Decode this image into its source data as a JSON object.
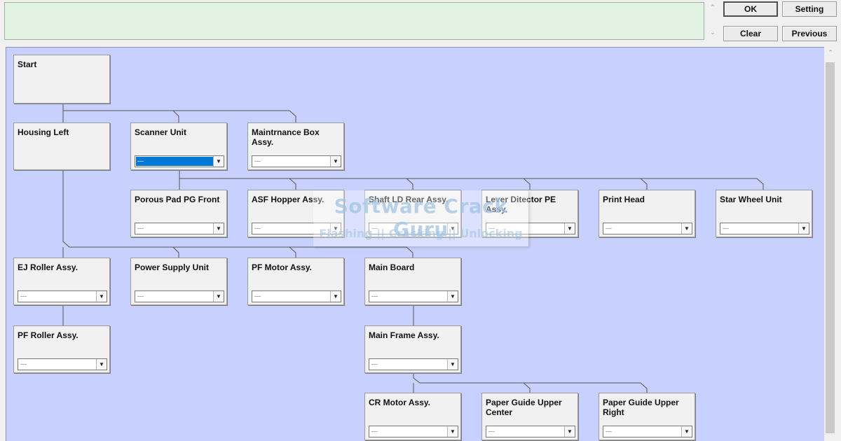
{
  "buttons": {
    "ok": "OK",
    "setting": "Setting",
    "clear": "Clear",
    "previous": "Previous"
  },
  "top_scroll": {
    "up": "⌃",
    "down": "⌄"
  },
  "canvas_color": "#c8d1fd",
  "watermark": {
    "title": "Software Crack Guru",
    "subtitle": "Flashing || Cracking || Unlocking"
  },
  "start": {
    "label": "Start"
  },
  "nodes": [
    {
      "id": "housing-left",
      "label": "Housing Left",
      "value": null
    },
    {
      "id": "scanner-unit",
      "label": "Scanner Unit",
      "value": "---",
      "selected": true
    },
    {
      "id": "maintrnance-box-assy",
      "label": "Maintrnance Box Assy.",
      "value": "---"
    },
    {
      "id": "porous-pad-pg-front",
      "label": "Porous Pad PG Front",
      "value": "---"
    },
    {
      "id": "asf-hopper-assy",
      "label": "ASF Hopper Assy.",
      "value": "---"
    },
    {
      "id": "shaft-ld-rear-assy",
      "label": "Shaft LD Rear Assy.",
      "value": "---"
    },
    {
      "id": "lever-ditector-pe-assy",
      "label": "Lever Ditector PE Assy.",
      "value": "---"
    },
    {
      "id": "print-head",
      "label": "Print Head",
      "value": "---"
    },
    {
      "id": "star-wheel-unit",
      "label": "Star Wheel Unit",
      "value": "---"
    },
    {
      "id": "ej-roller-assy",
      "label": "EJ Roller Assy.",
      "value": "---"
    },
    {
      "id": "power-supply-unit",
      "label": "Power Supply Unit",
      "value": "---"
    },
    {
      "id": "pf-motor-assy",
      "label": "PF Motor Assy.",
      "value": "---"
    },
    {
      "id": "main-board",
      "label": "Main Board",
      "value": "---"
    },
    {
      "id": "pf-roller-assy",
      "label": "PF Roller Assy.",
      "value": "---"
    },
    {
      "id": "main-frame-assy",
      "label": "Main Frame Assy.",
      "value": "---"
    },
    {
      "id": "cr-motor-assy",
      "label": "CR Motor Assy.",
      "value": "---"
    },
    {
      "id": "paper-guide-upper-center",
      "label": "Paper Guide Upper Center",
      "value": "---"
    },
    {
      "id": "paper-guide-upper-right",
      "label": "Paper Guide Upper Right",
      "value": "---"
    }
  ]
}
